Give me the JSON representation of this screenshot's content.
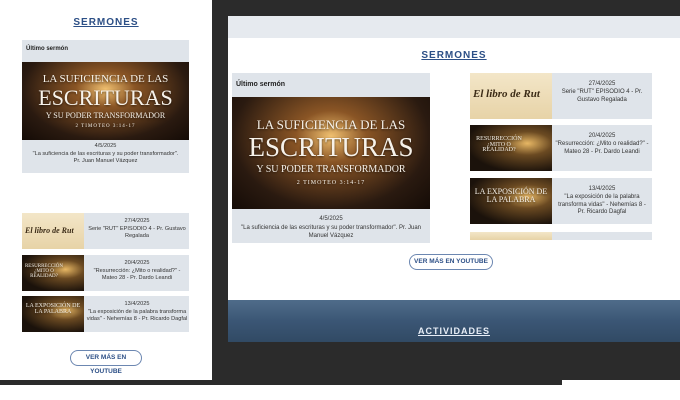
{
  "left": {
    "title": "SERMONES",
    "latest_label": "Último sermón",
    "hero": {
      "line1": "LA SUFICIENCIA DE LAS",
      "line2": "ESCRITURAS",
      "line3": "Y SU PODER TRANSFORMADOR",
      "ref": "2 TIMOTEO 3:14-17",
      "date": "4/5/2025",
      "caption": "\"La suficiencia de las escrituras y su poder transformador\". Pr. Juan Manuel Vázquez"
    },
    "list": [
      {
        "date": "27/4/2025",
        "desc": "Serie \"RUT\" EPISODIO 4 - Pr. Gustavo Regalada",
        "thumb_text": "El libro de Rut"
      },
      {
        "date": "20/4/2025",
        "desc": "\"Resurrección: ¿Mito o realidad?\" - Mateo 28 - Pr. Dardo Leandi",
        "thumb_text": "RESURRECCIÓN ¿MITO O REALIDAD?"
      },
      {
        "date": "13/4/2025",
        "desc": "\"La exposición de la palabra transforma vidas\" - Nehemías 8 - Pr. Ricardo Dagfal",
        "thumb_text": "LA EXPOSICIÓN DE LA PALABRA"
      }
    ],
    "youtube_button": "VER MÁS EN YOUTUBE"
  },
  "right": {
    "title": "SERMONES",
    "latest_label": "Último sermón",
    "hero": {
      "line1": "LA SUFICIENCIA DE LAS",
      "line2": "ESCRITURAS",
      "line3": "Y SU PODER TRANSFORMADOR",
      "ref": "2 TIMOTEO 3:14-17",
      "date": "4/5/2025",
      "caption": "\"La suficiencia de las escrituras y su poder transformador\". Pr. Juan Manuel Vázquez"
    },
    "list": [
      {
        "date": "27/4/2025",
        "desc": "Serie \"RUT\" EPISODIO 4 - Pr. Gustavo Regalada",
        "thumb_text": "El libro de Rut"
      },
      {
        "date": "20/4/2025",
        "desc": "\"Resurrección: ¿Mito o realidad?\" - Mateo 28 - Pr. Dardo Leandi",
        "thumb_text": "RESURRECCIÓN ¿MITO O REALIDAD?"
      },
      {
        "date": "13/4/2025",
        "desc": "\"La exposición de la palabra transforma vidas\" - Nehemías 8 - Pr. Ricardo Dagfal",
        "thumb_text": "LA EXPOSICIÓN DE LA PALABRA"
      }
    ],
    "youtube_button": "VER MÁS EN YOUTUBE",
    "activities_title": "ACTIVIDADES"
  },
  "colors": {
    "title_blue": "#2c4f86",
    "card_bg": "#dfe4ea",
    "dark_bg": "#2b2b2b"
  }
}
